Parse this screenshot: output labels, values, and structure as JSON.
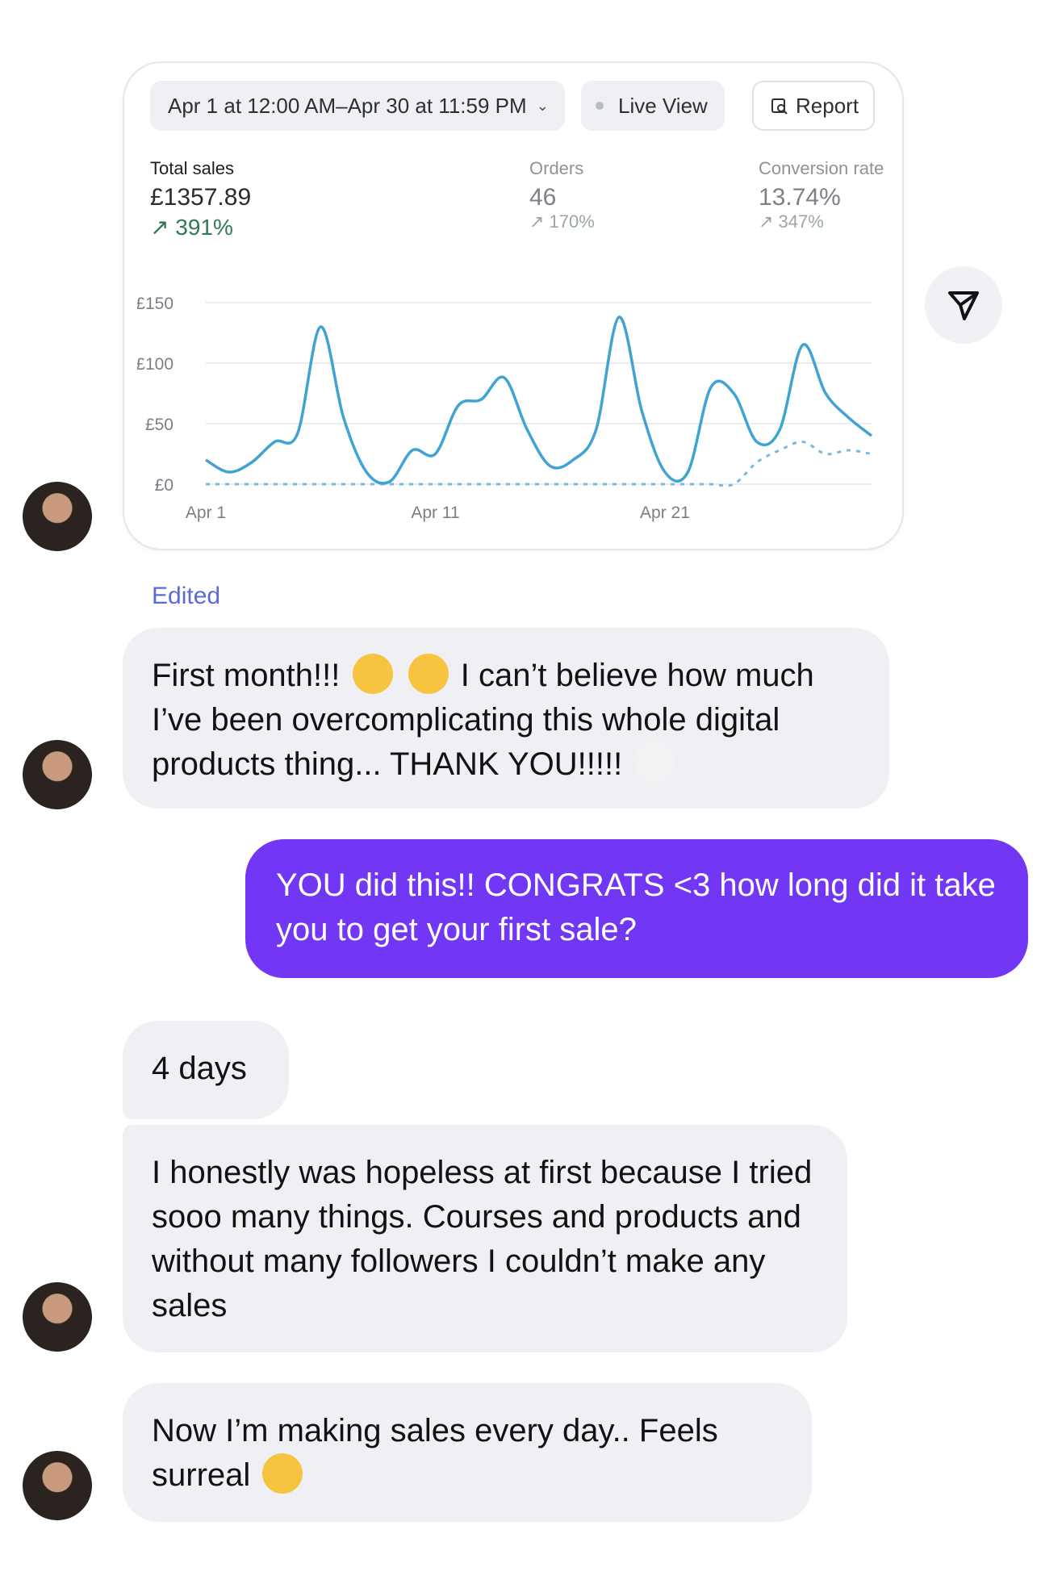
{
  "dashboard": {
    "date_range": "Apr 1 at 12:00 AM–Apr 30 at 11:59 PM",
    "live_view_label": "Live View",
    "report_label": "Report",
    "metrics": [
      {
        "label": "Total sales",
        "value": "£1357.89",
        "change": "↗ 391%"
      },
      {
        "label": "Orders",
        "value": "46",
        "change": "↗ 170%"
      },
      {
        "label": "Conversion rate",
        "value": "13.74%",
        "change": "↗ 347%"
      }
    ],
    "colors": {
      "primary_line": "#3fa3d3",
      "comparison_line": "#79b9dd",
      "positive_change": "#2f7a55"
    }
  },
  "chart_data": {
    "type": "line",
    "title": "",
    "xlabel": "",
    "ylabel": "",
    "ylim": [
      0,
      150
    ],
    "y_ticks": [
      "£150",
      "£100",
      "£50",
      "£0"
    ],
    "x_ticks": [
      "Apr 1",
      "Apr 11",
      "Apr 21"
    ],
    "x": [
      1,
      2,
      3,
      4,
      5,
      6,
      7,
      8,
      9,
      10,
      11,
      12,
      13,
      14,
      15,
      16,
      17,
      18,
      19,
      20,
      21,
      22,
      23,
      24,
      25,
      26,
      27,
      28,
      29,
      30
    ],
    "series": [
      {
        "values": [
          20,
          10,
          18,
          35,
          42,
          130,
          55,
          10,
          2,
          28,
          25,
          65,
          70,
          88,
          45,
          15,
          20,
          45,
          138,
          60,
          10,
          10,
          80,
          75,
          35,
          45,
          115,
          75,
          55,
          40
        ]
      },
      {
        "values": [
          0,
          0,
          0,
          0,
          0,
          0,
          0,
          0,
          0,
          0,
          0,
          0,
          0,
          0,
          0,
          0,
          0,
          0,
          0,
          0,
          0,
          0,
          0,
          0,
          18,
          28,
          35,
          25,
          28,
          25
        ]
      }
    ],
    "grid": true
  },
  "conversation": {
    "edited_label": "Edited",
    "messages": [
      {
        "part1": "First month!!!",
        "part2": "I can’t believe how much I’ve been overcomplicating this whole digital products thing... THANK YOU!!!!!"
      },
      {
        "text": "YOU did this!! CONGRATS <3 how long did it take you to get your first sale?"
      },
      {
        "text": "4 days"
      },
      {
        "text": "I honestly was hopeless at first because I tried sooo many things. Courses and products and without many followers I couldn’t make any sales"
      },
      {
        "part1": "Now I’m making sales every day.. Feels surreal"
      }
    ]
  },
  "icons": {
    "send": "send-icon",
    "report": "report-search-icon",
    "chevron": "chevron-down-icon"
  }
}
